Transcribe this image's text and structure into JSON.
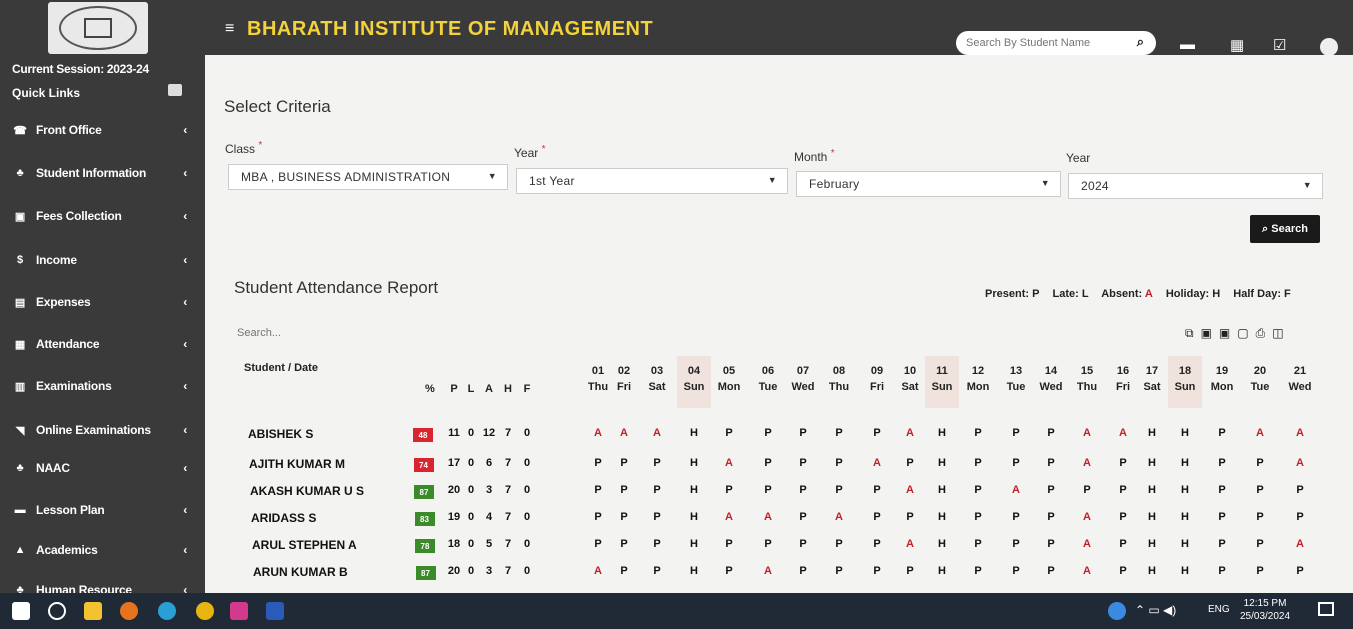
{
  "sidebar": {
    "session": "Current Session: 2023-24",
    "quick_links": "Quick Links",
    "items": [
      {
        "label": "Front Office",
        "icon": "headset-icon"
      },
      {
        "label": "Student Information",
        "icon": "users-icon"
      },
      {
        "label": "Fees Collection",
        "icon": "money-icon"
      },
      {
        "label": "Income",
        "icon": "dollar-icon"
      },
      {
        "label": "Expenses",
        "icon": "credit-card-icon"
      },
      {
        "label": "Attendance",
        "icon": "calendar-check-icon"
      },
      {
        "label": "Examinations",
        "icon": "map-icon"
      },
      {
        "label": "Online Examinations",
        "icon": "rss-icon"
      },
      {
        "label": "NAAC",
        "icon": "users-icon"
      },
      {
        "label": "Lesson Plan",
        "icon": "list-icon"
      },
      {
        "label": "Academics",
        "icon": "graduation-cap-icon"
      },
      {
        "label": "Human Resource",
        "icon": "users-icon"
      }
    ]
  },
  "topbar": {
    "title": "BHARATH INSTITUTE OF MANAGEMENT",
    "search_placeholder": "Search By Student Name"
  },
  "criteria": {
    "heading": "Select Criteria",
    "class_label": "Class",
    "class_value": "MBA , BUSINESS ADMINISTRATION",
    "year_label": "Year",
    "year_value": "1st Year",
    "month_label": "Month",
    "month_value": "February",
    "year2_label": "Year",
    "year2_value": "2024",
    "search_button": "Search"
  },
  "report": {
    "heading": "Student Attendance Report",
    "search_placeholder": "Search...",
    "legend": {
      "present": "Present: P",
      "late": "Late: L",
      "absent_label": "Absent:",
      "absent_code": "A",
      "holiday": "Holiday: H",
      "halfday": "Half Day: F"
    },
    "columns": {
      "student": "Student / Date",
      "pct": "%",
      "summary": [
        "P",
        "L",
        "A",
        "H",
        "F"
      ]
    },
    "days": [
      {
        "d": "01",
        "w": "Thu"
      },
      {
        "d": "02",
        "w": "Fri"
      },
      {
        "d": "03",
        "w": "Sat"
      },
      {
        "d": "04",
        "w": "Sun"
      },
      {
        "d": "05",
        "w": "Mon"
      },
      {
        "d": "06",
        "w": "Tue"
      },
      {
        "d": "07",
        "w": "Wed"
      },
      {
        "d": "08",
        "w": "Thu"
      },
      {
        "d": "09",
        "w": "Fri"
      },
      {
        "d": "10",
        "w": "Sat"
      },
      {
        "d": "11",
        "w": "Sun"
      },
      {
        "d": "12",
        "w": "Mon"
      },
      {
        "d": "13",
        "w": "Tue"
      },
      {
        "d": "14",
        "w": "Wed"
      },
      {
        "d": "15",
        "w": "Thu"
      },
      {
        "d": "16",
        "w": "Fri"
      },
      {
        "d": "17",
        "w": "Sat"
      },
      {
        "d": "18",
        "w": "Sun"
      },
      {
        "d": "19",
        "w": "Mon"
      },
      {
        "d": "20",
        "w": "Tue"
      },
      {
        "d": "21",
        "w": "Wed"
      }
    ],
    "rows": [
      {
        "name": "ABISHEK S",
        "pct": "48",
        "pct_color": "#d9262e",
        "summary": [
          "11",
          "0",
          "12",
          "7",
          "0"
        ],
        "marks": [
          "A",
          "A",
          "A",
          "H",
          "P",
          "P",
          "P",
          "P",
          "P",
          "A",
          "H",
          "P",
          "P",
          "P",
          "A",
          "A",
          "H",
          "H",
          "P",
          "A",
          "A"
        ]
      },
      {
        "name": "AJITH KUMAR M",
        "pct": "74",
        "pct_color": "#d9262e",
        "summary": [
          "17",
          "0",
          "6",
          "7",
          "0"
        ],
        "marks": [
          "P",
          "P",
          "P",
          "H",
          "A",
          "P",
          "P",
          "P",
          "A",
          "P",
          "H",
          "P",
          "P",
          "P",
          "A",
          "P",
          "H",
          "H",
          "P",
          "P",
          "A"
        ]
      },
      {
        "name": "AKASH KUMAR U S",
        "pct": "87",
        "pct_color": "#3c8b2a",
        "summary": [
          "20",
          "0",
          "3",
          "7",
          "0"
        ],
        "marks": [
          "P",
          "P",
          "P",
          "H",
          "P",
          "P",
          "P",
          "P",
          "P",
          "A",
          "H",
          "P",
          "A",
          "P",
          "P",
          "P",
          "H",
          "H",
          "P",
          "P",
          "P"
        ]
      },
      {
        "name": "ARIDASS S",
        "pct": "83",
        "pct_color": "#3c8b2a",
        "summary": [
          "19",
          "0",
          "4",
          "7",
          "0"
        ],
        "marks": [
          "P",
          "P",
          "P",
          "H",
          "A",
          "A",
          "P",
          "A",
          "P",
          "P",
          "H",
          "P",
          "P",
          "P",
          "A",
          "P",
          "H",
          "H",
          "P",
          "P",
          "P"
        ]
      },
      {
        "name": "ARUL STEPHEN A",
        "pct": "78",
        "pct_color": "#3c8b2a",
        "summary": [
          "18",
          "0",
          "5",
          "7",
          "0"
        ],
        "marks": [
          "P",
          "P",
          "P",
          "H",
          "P",
          "P",
          "P",
          "P",
          "P",
          "A",
          "H",
          "P",
          "P",
          "P",
          "A",
          "P",
          "H",
          "H",
          "P",
          "P",
          "A"
        ]
      },
      {
        "name": "ARUN KUMAR B",
        "pct": "87",
        "pct_color": "#3c8b2a",
        "summary": [
          "20",
          "0",
          "3",
          "7",
          "0"
        ],
        "marks": [
          "A",
          "P",
          "P",
          "H",
          "P",
          "A",
          "P",
          "P",
          "P",
          "P",
          "H",
          "P",
          "P",
          "P",
          "A",
          "P",
          "H",
          "H",
          "P",
          "P",
          "P"
        ]
      }
    ]
  },
  "taskbar": {
    "lang": "ENG",
    "time": "12:15 PM",
    "date": "25/03/2024"
  }
}
